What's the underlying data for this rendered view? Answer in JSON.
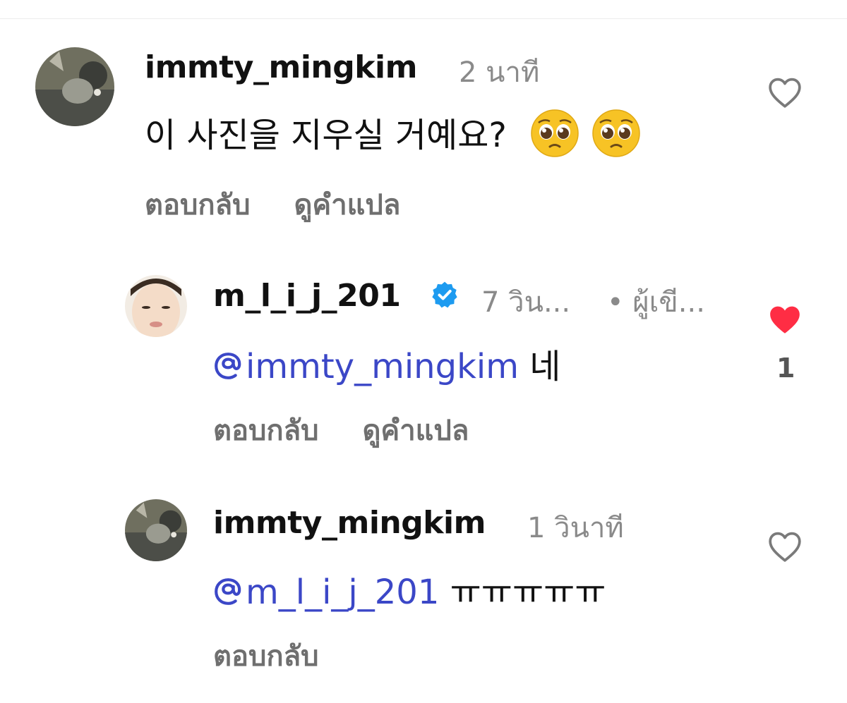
{
  "comments": [
    {
      "username": "immty_mingkim",
      "time": "2 นาที",
      "text": "이 사진을 지우실 거예요?",
      "emoji": "pleading-face",
      "reply_label": "ตอบกลับ",
      "translate_label": "ดูคำแปล",
      "liked": false
    },
    {
      "username": "m_l_i_j_201",
      "verified": true,
      "time": "7 วิน...",
      "author_badge": "• ผู้เขี...",
      "mention": "immty_mingkim",
      "text": " 네",
      "reply_label": "ตอบกลับ",
      "translate_label": "ดูคำแปล",
      "liked": true,
      "like_count": "1",
      "heart_color": "#ff2d44"
    },
    {
      "username": "immty_mingkim",
      "time": "1 วินาที",
      "mention": "m_l_i_j_201",
      "text": " ㅠㅠㅠㅠㅠ",
      "reply_label": "ตอบกลับ",
      "liked": false
    }
  ],
  "colors": {
    "mention": "#3b47c7",
    "verified": "#1d9bf0",
    "heart_liked": "#ff2d44"
  },
  "icons": [
    "heart-outline-icon",
    "heart-filled-icon",
    "verified-badge-icon",
    "threads-at-icon"
  ]
}
